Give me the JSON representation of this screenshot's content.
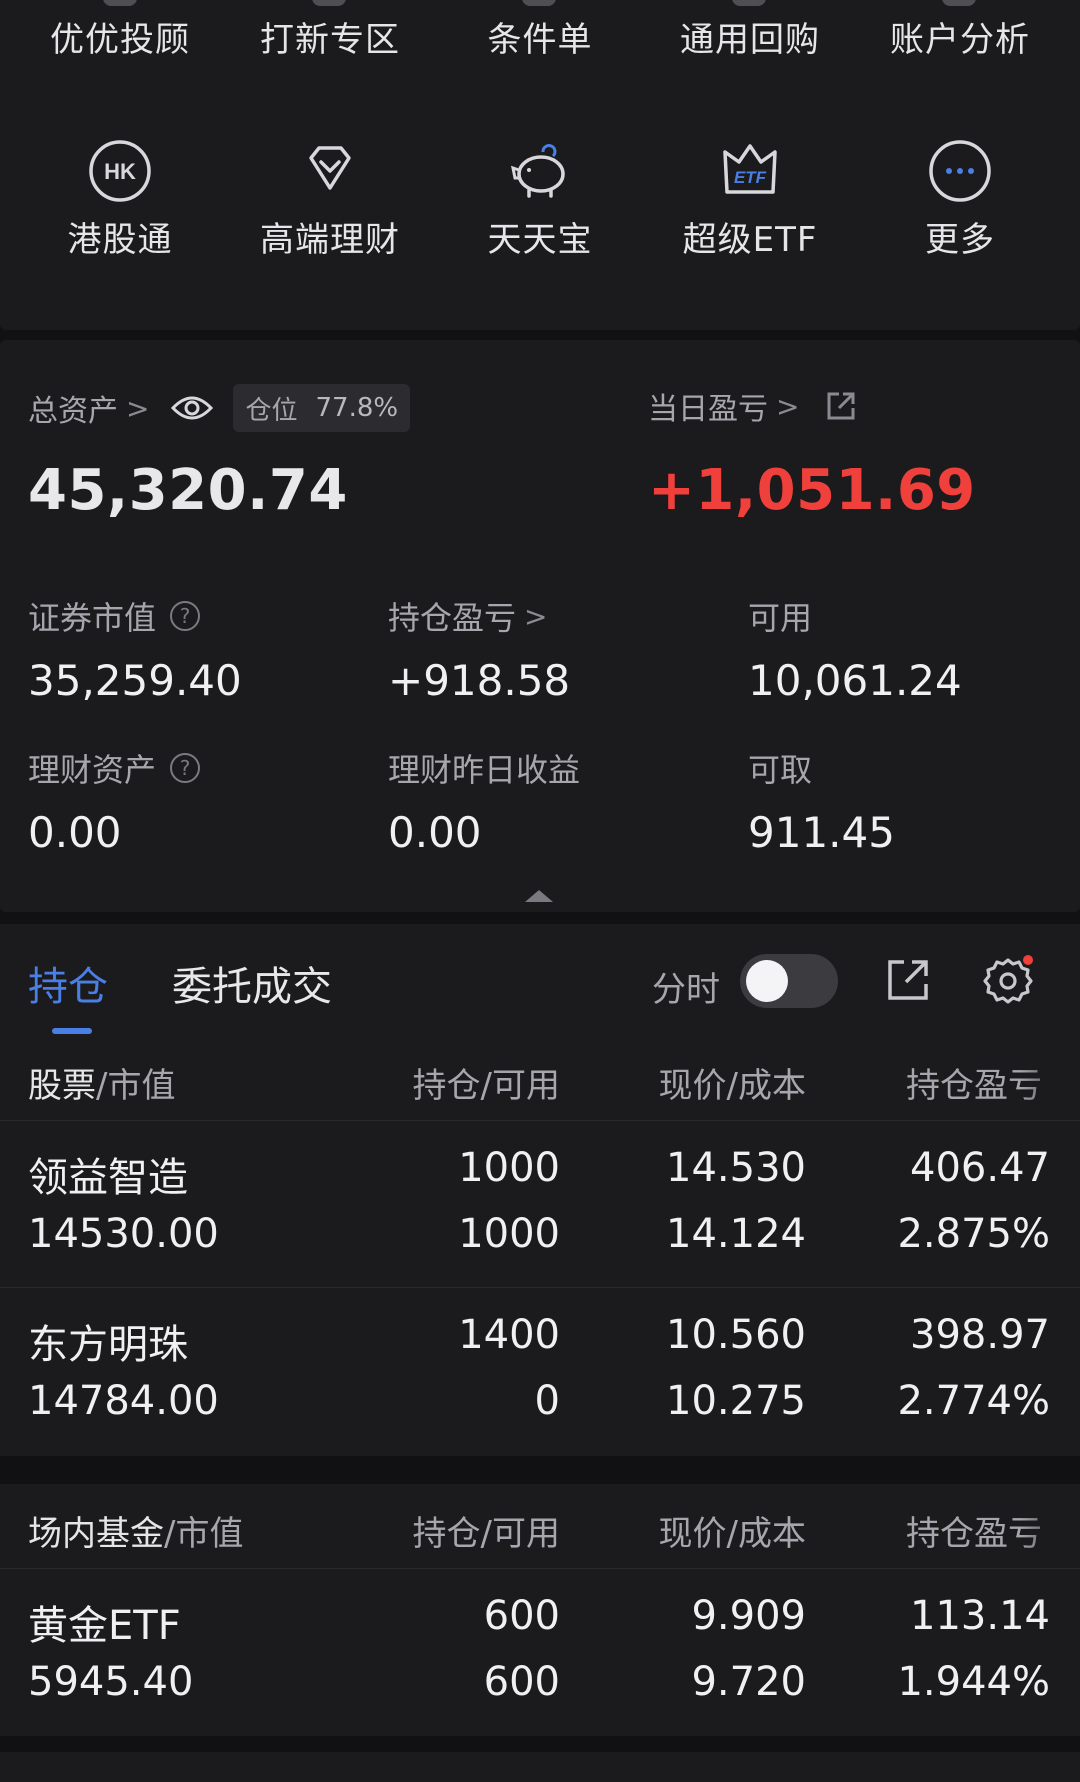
{
  "shortcuts_row1": [
    {
      "label": "优优投顾"
    },
    {
      "label": "打新专区"
    },
    {
      "label": "条件单"
    },
    {
      "label": "通用回购"
    },
    {
      "label": "账户分析"
    }
  ],
  "shortcuts_row2": [
    {
      "label": "港股通",
      "icon": "hk-icon",
      "icon_text": "HK"
    },
    {
      "label": "高端理财",
      "icon": "diamond-icon"
    },
    {
      "label": "天天宝",
      "icon": "piggy-bank-icon"
    },
    {
      "label": "超级ETF",
      "icon": "etf-crown-icon",
      "icon_text": "ETF"
    },
    {
      "label": "更多",
      "icon": "more-icon"
    }
  ],
  "assets": {
    "total_label": "总资产",
    "position_label": "仓位",
    "position_value": "77.8%",
    "total_value": "45,320.74",
    "daily_pl_label": "当日盈亏",
    "daily_pl_value": "+1,051.69",
    "market_value_label": "证券市值",
    "market_value": "35,259.40",
    "holding_pl_label": "持仓盈亏",
    "holding_pl_value": "+918.58",
    "available_label": "可用",
    "available_value": "10,061.24",
    "wealth_label": "理财资产",
    "wealth_value": "0.00",
    "wealth_yesterday_label": "理财昨日收益",
    "wealth_yesterday_value": "0.00",
    "withdrawable_label": "可取",
    "withdrawable_value": "911.45"
  },
  "tabs": {
    "holdings": "持仓",
    "orders": "委托成交",
    "fenshi": "分时"
  },
  "stocks_header": {
    "col1_a": "股票",
    "col1_b": "/市值",
    "col2": "持仓/可用",
    "col3": "现价/成本",
    "col4": "持仓盈亏"
  },
  "stocks": [
    {
      "name": "领益智造",
      "mv": "14530.00",
      "hold": "1000",
      "avail": "1000",
      "price": "14.530",
      "cost": "14.124",
      "pl": "406.47",
      "pl_pct": "2.875%"
    },
    {
      "name": "东方明珠",
      "mv": "14784.00",
      "hold": "1400",
      "avail": "0",
      "price": "10.560",
      "cost": "10.275",
      "pl": "398.97",
      "pl_pct": "2.774%"
    }
  ],
  "funds_header": {
    "col1_a": "场内基金",
    "col1_b": "/市值",
    "col2": "持仓/可用",
    "col3": "现价/成本",
    "col4": "持仓盈亏"
  },
  "funds": [
    {
      "name": "黄金ETF",
      "mv": "5945.40",
      "hold": "600",
      "avail": "600",
      "price": "9.909",
      "cost": "9.720",
      "pl": "113.14",
      "pl_pct": "1.944%"
    }
  ],
  "colors": {
    "accent": "#4a7fe6",
    "gain": "#f0403c",
    "panel": "#1b1b1e",
    "bg": "#111113"
  }
}
